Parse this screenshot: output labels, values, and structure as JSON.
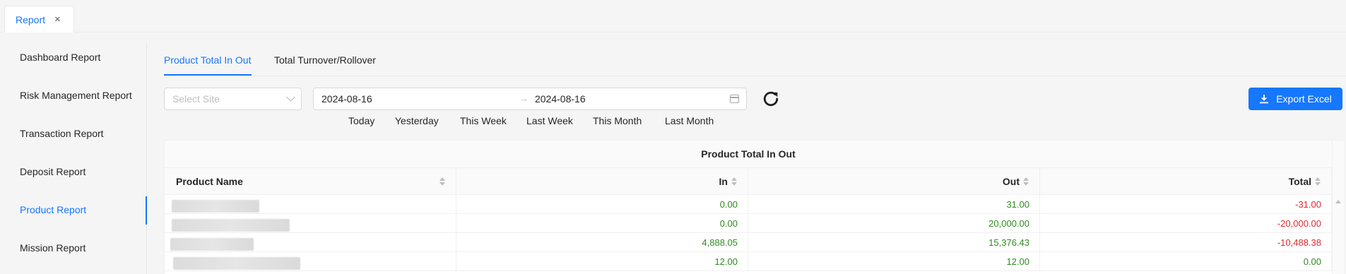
{
  "top_tab": {
    "label": "Report",
    "close": "×"
  },
  "sidebar": {
    "items": [
      {
        "label": "Dashboard Report",
        "active": false
      },
      {
        "label": "Risk Management Report",
        "active": false
      },
      {
        "label": "Transaction Report",
        "active": false
      },
      {
        "label": "Deposit Report",
        "active": false
      },
      {
        "label": "Product Report",
        "active": true
      },
      {
        "label": "Mission Report",
        "active": false
      }
    ]
  },
  "tabs": [
    {
      "label": "Product Total In Out",
      "active": true
    },
    {
      "label": "Total Turnover/Rollover",
      "active": false
    }
  ],
  "filters": {
    "site_placeholder": "Select Site",
    "date_start": "2024-08-16",
    "date_separator": "→",
    "date_end": "2024-08-16",
    "quick_ranges": [
      "Today",
      "Yesterday",
      "This Week",
      "Last Week",
      "This Month",
      "Last Month"
    ]
  },
  "export_label": "Export Excel",
  "table": {
    "group_title": "Product Total In Out",
    "columns": [
      "Product Name",
      "In",
      "Out",
      "Total"
    ],
    "rows": [
      {
        "product": "",
        "in": "0.00",
        "out": "31.00",
        "total": "-31.00"
      },
      {
        "product": "",
        "in": "0.00",
        "out": "20,000.00",
        "total": "-20,000.00"
      },
      {
        "product": "",
        "in": "4,888.05",
        "out": "15,376.43",
        "total": "-10,488.38"
      },
      {
        "product": "",
        "in": "12.00",
        "out": "12.00",
        "total": "0.00"
      }
    ]
  },
  "colors": {
    "accent": "#1677ff",
    "positive": "#2e8b1f",
    "negative": "#e0282e"
  }
}
